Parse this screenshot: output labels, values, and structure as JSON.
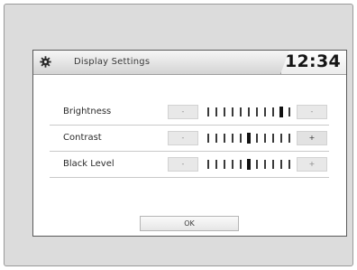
{
  "window": {
    "title": "Display Settings",
    "clock": "12:34",
    "icon": "gear-icon"
  },
  "settings": [
    {
      "label": "Brightness",
      "minus_label": "-",
      "plus_label": "-",
      "ticks": 11,
      "level_fraction": 0.9
    },
    {
      "label": "Contrast",
      "minus_label": "-",
      "plus_label": "+",
      "ticks": 11,
      "level_fraction": 0.5
    },
    {
      "label": "Black Level",
      "minus_label": "-",
      "plus_label": "+",
      "ticks": 11,
      "level_fraction": 0.5
    }
  ],
  "ok_label": "OK",
  "colors": {
    "title_bar": "#e4e4e4",
    "marker": "#111111",
    "button_bg": "#e8e8e8"
  }
}
